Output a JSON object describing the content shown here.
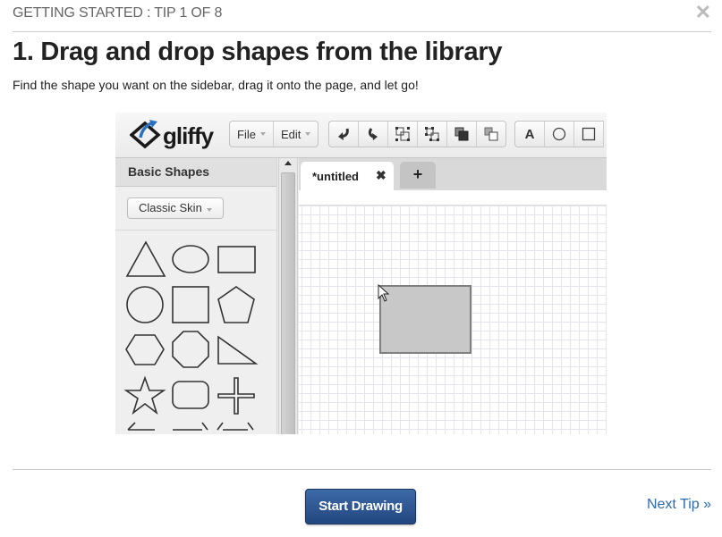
{
  "dialog": {
    "header": "GETTING STARTED :  TIP 1 OF 8",
    "close_glyph": "✕",
    "title": "1. Drag and drop shapes from the library",
    "subtitle": "Find the shape you want on the sidebar, drag it onto the page, and let go!",
    "start_button": "Start Drawing",
    "next_tip": "Next Tip »"
  },
  "illustration": {
    "logo": "gliffy",
    "menus": [
      {
        "label": "File"
      },
      {
        "label": "Edit"
      }
    ],
    "toolbar_icons": [
      "undo-icon",
      "redo-icon",
      "group-icon",
      "ungroup-icon",
      "bring-to-front-icon",
      "send-to-back-icon",
      "text-tool-icon",
      "ellipse-tool-icon",
      "rectangle-tool-icon"
    ],
    "text_tool_glyph": "A",
    "sidebar": {
      "title": "Basic Shapes",
      "skin_button": "Classic Skin",
      "shapes": [
        "triangle",
        "ellipse",
        "rectangle",
        "circle",
        "square",
        "pentagon",
        "hexagon",
        "octagon",
        "right-triangle",
        "star",
        "rounded-rectangle",
        "cross",
        "left-arrow",
        "right-arrow",
        "double-arrow"
      ]
    },
    "tab": {
      "label": "*untitled",
      "close_glyph": "✖",
      "add_glyph": "+"
    }
  }
}
